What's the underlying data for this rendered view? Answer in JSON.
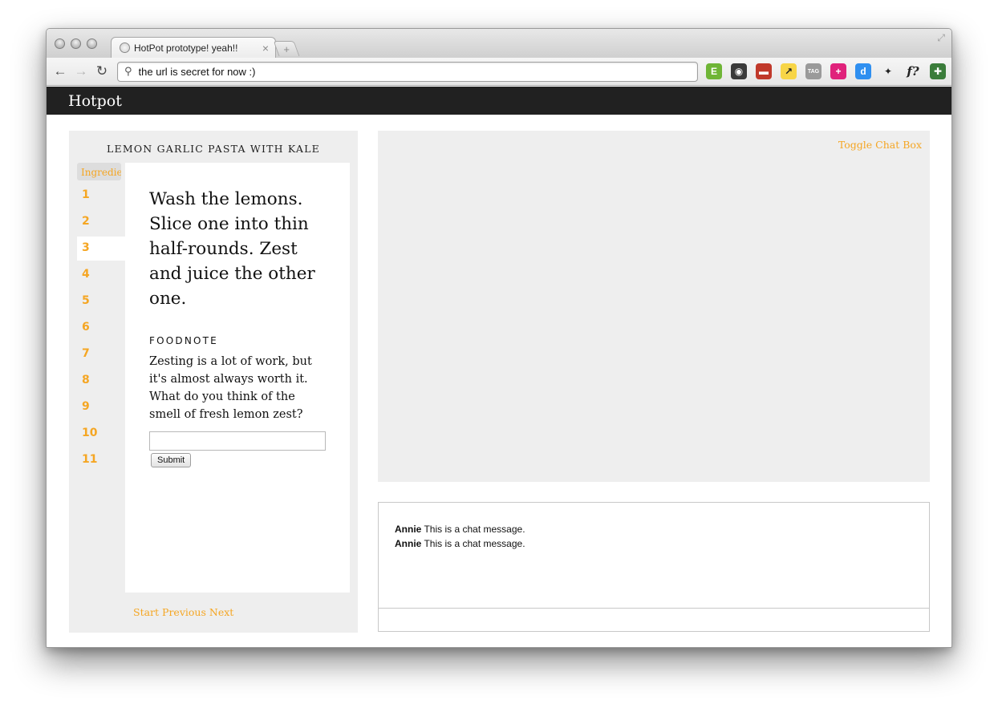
{
  "browser": {
    "tab_title": "HotPot prototype! yeah!!",
    "tab_close": "×",
    "new_tab": "+",
    "url": "the url is secret for now :)",
    "fullscreen_glyph": "⤢",
    "nav": {
      "back": "←",
      "forward": "→",
      "reload": "↻",
      "search_glyph": "⚲"
    },
    "extensions": [
      {
        "name": "evernote-icon",
        "glyph": "E",
        "color": "#6fb536"
      },
      {
        "name": "color-picker-icon",
        "glyph": "◉",
        "color": "#3a3a3a"
      },
      {
        "name": "couch-icon",
        "glyph": "▬",
        "color": "#c0392b"
      },
      {
        "name": "sticky-note-icon",
        "glyph": "↗",
        "color": "#f7d547"
      },
      {
        "name": "tag-icon",
        "glyph": "TAG",
        "color": "#9a9a9a"
      },
      {
        "name": "plus-circle-icon",
        "glyph": "+",
        "color": "#e0227b"
      },
      {
        "name": "delicious-icon",
        "glyph": "d",
        "color": "#2f8ff0"
      },
      {
        "name": "pin-icon",
        "glyph": "✦",
        "color": "#ffffff"
      },
      {
        "name": "whatfont-icon",
        "glyph": "f?",
        "color": "#ffffff"
      },
      {
        "name": "wrench-icon",
        "glyph": "✚",
        "color": "#3b7d3b"
      }
    ]
  },
  "app": {
    "brand": "Hotpot"
  },
  "recipe": {
    "title": "LEMON GARLIC PASTA WITH KALE",
    "ingredients_tab": "Ingredients",
    "steps": [
      "1",
      "2",
      "3",
      "4",
      "5",
      "6",
      "7",
      "8",
      "9",
      "10",
      "11"
    ],
    "active_step": "3",
    "step_text": "Wash the lemons. Slice one into thin half-rounds. Zest and juice the other one.",
    "foodnote_heading": "FOODNOTE",
    "foodnote_text": "Zesting is a lot of work, but it's almost always worth it. What do you think of the smell of fresh lemon zest?",
    "foodnote_input_value": "",
    "submit_label": "Submit",
    "pager": {
      "start": "Start",
      "previous": "Previous",
      "next": "Next"
    }
  },
  "video": {
    "toggle_chat": "Toggle Chat Box"
  },
  "chat": {
    "messages": [
      {
        "author": "Annie",
        "text": "This is a chat message."
      },
      {
        "author": "Annie",
        "text": "This is a chat message."
      }
    ],
    "input_value": ""
  },
  "colors": {
    "accent": "#f5a623",
    "header_bg": "#212121",
    "panel_bg": "#eeeeee"
  }
}
